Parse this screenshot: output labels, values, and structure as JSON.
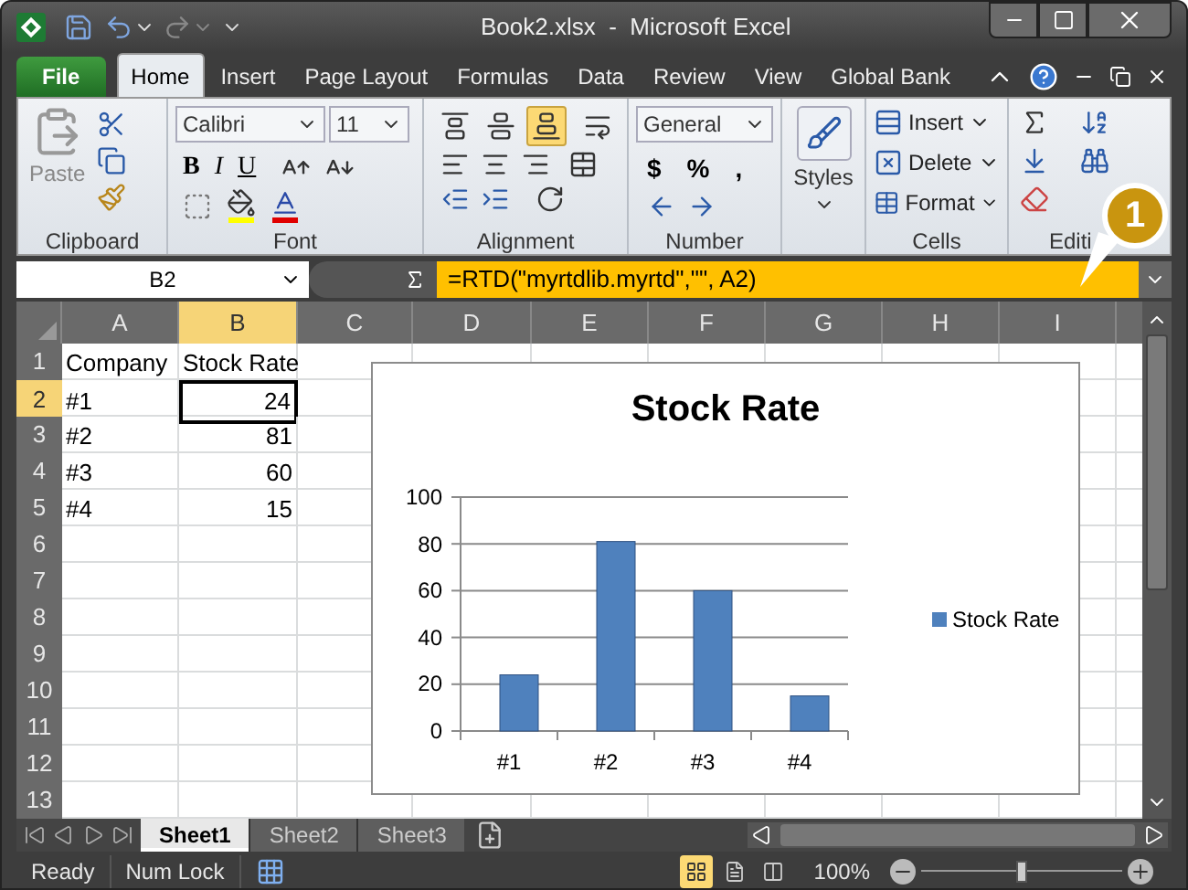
{
  "window": {
    "title": "Book2.xlsx  -  Microsoft Excel"
  },
  "ribbon_tabs": [
    {
      "label": "File",
      "kind": "file",
      "selected": false
    },
    {
      "label": "Home",
      "kind": "tab",
      "selected": true
    },
    {
      "label": "Insert",
      "kind": "tab",
      "selected": false
    },
    {
      "label": "Page Layout",
      "kind": "tab",
      "selected": false
    },
    {
      "label": "Formulas",
      "kind": "tab",
      "selected": false
    },
    {
      "label": "Data",
      "kind": "tab",
      "selected": false
    },
    {
      "label": "Review",
      "kind": "tab",
      "selected": false
    },
    {
      "label": "View",
      "kind": "tab",
      "selected": false
    },
    {
      "label": "Global Bank",
      "kind": "tab",
      "selected": false
    }
  ],
  "ribbon": {
    "clipboard": {
      "paste": "Paste",
      "label": "Clipboard"
    },
    "font": {
      "name": "Calibri",
      "size": "11",
      "styles": [
        "B",
        "I",
        "U"
      ],
      "label": "Font"
    },
    "alignment": {
      "vertical": [
        {
          "selected": false
        },
        {
          "selected": false
        },
        {
          "selected": true
        }
      ],
      "label": "Alignment"
    },
    "number": {
      "format": "General",
      "symbols": [
        "$",
        "%",
        ","
      ],
      "label": "Number"
    },
    "styles": {
      "label": "Styles"
    },
    "cells": {
      "buttons": [
        "Insert",
        "Delete",
        "Format"
      ],
      "label": "Cells"
    },
    "editing": {
      "label": "Editi"
    }
  },
  "formula_bar": {
    "name_box": "B2",
    "formula": "=RTD(\"myrtdlib.myrtd\",\"\", A2)"
  },
  "callout": {
    "label": "1"
  },
  "sheet": {
    "columns": [
      {
        "label": "A",
        "selected": false
      },
      {
        "label": "B",
        "selected": true
      },
      {
        "label": "C",
        "selected": false
      },
      {
        "label": "D",
        "selected": false
      },
      {
        "label": "E",
        "selected": false
      },
      {
        "label": "F",
        "selected": false
      },
      {
        "label": "G",
        "selected": false
      },
      {
        "label": "H",
        "selected": false
      },
      {
        "label": "I",
        "selected": false
      }
    ],
    "rows": [
      {
        "label": "1",
        "selected": false,
        "cells": [
          "Company",
          "Stock Rate"
        ]
      },
      {
        "label": "2",
        "selected": true,
        "cells": [
          "#1",
          "24"
        ]
      },
      {
        "label": "3",
        "selected": false,
        "cells": [
          "#2",
          "81"
        ]
      },
      {
        "label": "4",
        "selected": false,
        "cells": [
          "#3",
          "60"
        ]
      },
      {
        "label": "5",
        "selected": false,
        "cells": [
          "#4",
          "15"
        ]
      },
      {
        "label": "6",
        "selected": false,
        "cells": []
      },
      {
        "label": "7",
        "selected": false,
        "cells": []
      },
      {
        "label": "8",
        "selected": false,
        "cells": []
      },
      {
        "label": "9",
        "selected": false,
        "cells": []
      },
      {
        "label": "10",
        "selected": false,
        "cells": []
      },
      {
        "label": "11",
        "selected": false,
        "cells": []
      },
      {
        "label": "12",
        "selected": false,
        "cells": []
      },
      {
        "label": "13",
        "selected": false,
        "cells": []
      }
    ],
    "chart_data": {
      "type": "bar",
      "title": "Stock Rate",
      "categories": [
        "#1",
        "#2",
        "#3",
        "#4"
      ],
      "series": [
        {
          "name": "Stock Rate",
          "color": "#4f81bd",
          "values": [
            24,
            81,
            60,
            15
          ]
        }
      ],
      "ylim": [
        0,
        100
      ],
      "grid": true,
      "yticks": [
        0,
        20,
        40,
        60,
        80,
        100
      ]
    }
  },
  "sheet_tabs": [
    {
      "label": "Sheet1",
      "selected": true
    },
    {
      "label": "Sheet2",
      "selected": false
    },
    {
      "label": "Sheet3",
      "selected": false
    }
  ],
  "status_bar": {
    "mode": "Ready",
    "num_lock": "Num Lock",
    "views": [
      {
        "selected": true
      },
      {
        "selected": false
      },
      {
        "selected": false
      }
    ],
    "zoom": "100%",
    "zoom_slider": {
      "level": 0.5
    }
  }
}
